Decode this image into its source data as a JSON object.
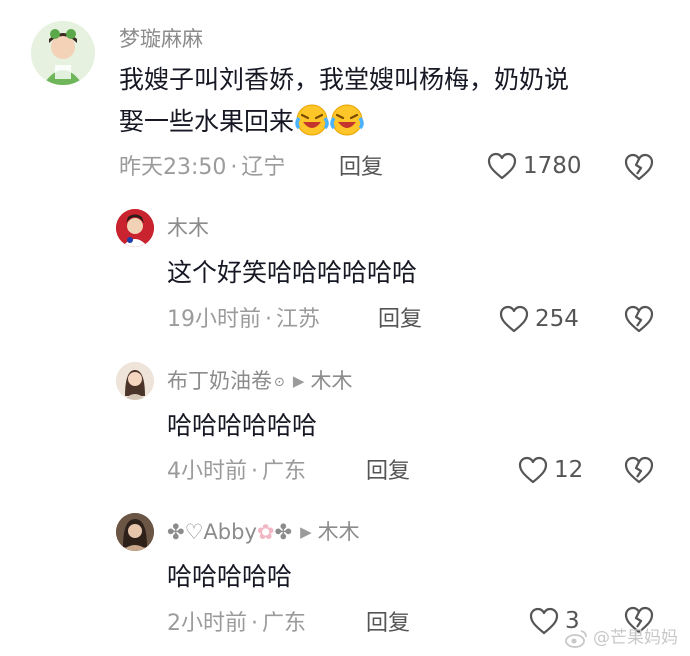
{
  "comments": [
    {
      "user": "梦璇麻麻",
      "text_line1": "我嫂子叫刘香娇，我堂嫂叫杨梅，奶奶说",
      "text_line2": "娶一些水果回来",
      "time": "昨天23:50",
      "location": "辽宁",
      "reply_label": "回复",
      "likes": "1780"
    },
    {
      "user": "木木",
      "text": "这个好笑哈哈哈哈哈哈",
      "time": "19小时前",
      "location": "江苏",
      "reply_label": "回复",
      "likes": "254"
    },
    {
      "user": "布丁奶油卷",
      "reply_to": "木木",
      "text": "哈哈哈哈哈哈",
      "time": "4小时前",
      "location": "广东",
      "reply_label": "回复",
      "likes": "12"
    },
    {
      "user_prefix": "✤♡Abby",
      "user_suffix": "✤",
      "reply_to": "木木",
      "text": "哈哈哈哈哈",
      "time": "2小时前",
      "location": "广东",
      "reply_label": "回复",
      "likes": "3"
    }
  ],
  "meta_separator": "·",
  "watermark": "@芒果妈妈",
  "icons": {
    "like": "heart-outline-icon",
    "dislike": "broken-heart-icon",
    "emoji": "laughing-crying-emoji-icon"
  },
  "colors": {
    "text": "#161823",
    "meta": "#9b9b9b",
    "name": "#8c8c8c"
  }
}
